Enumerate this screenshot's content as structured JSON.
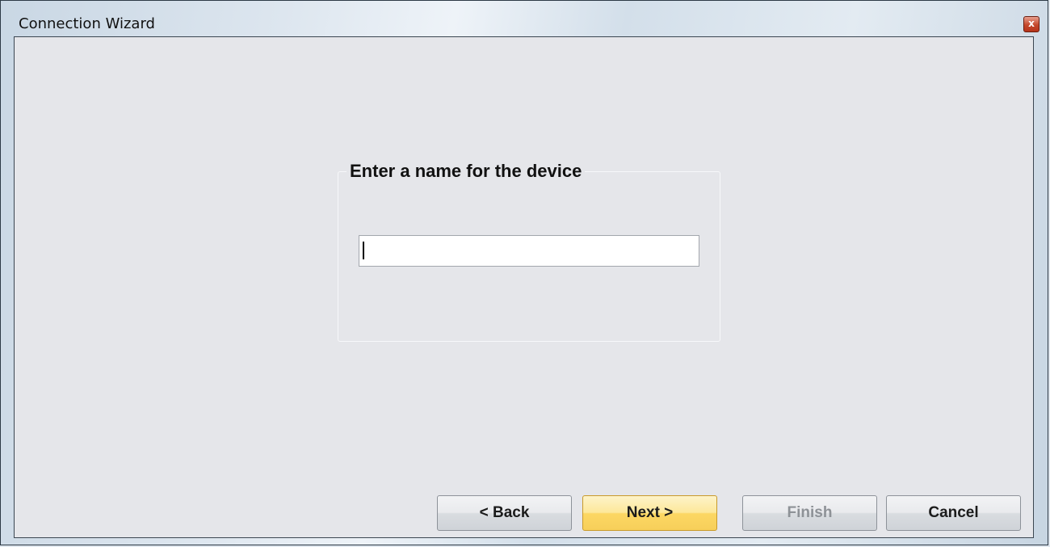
{
  "window": {
    "title": "Connection Wizard",
    "close_glyph": "x"
  },
  "group": {
    "legend": "Enter a name for the device"
  },
  "name_input": {
    "value": "",
    "placeholder": ""
  },
  "buttons": {
    "back": "< Back",
    "next": "Next >",
    "finish": "Finish",
    "cancel": "Cancel"
  },
  "colors": {
    "client_bg": "#e5e6ea",
    "default_button": "#fcd763",
    "disabled_text": "#8e9297"
  }
}
